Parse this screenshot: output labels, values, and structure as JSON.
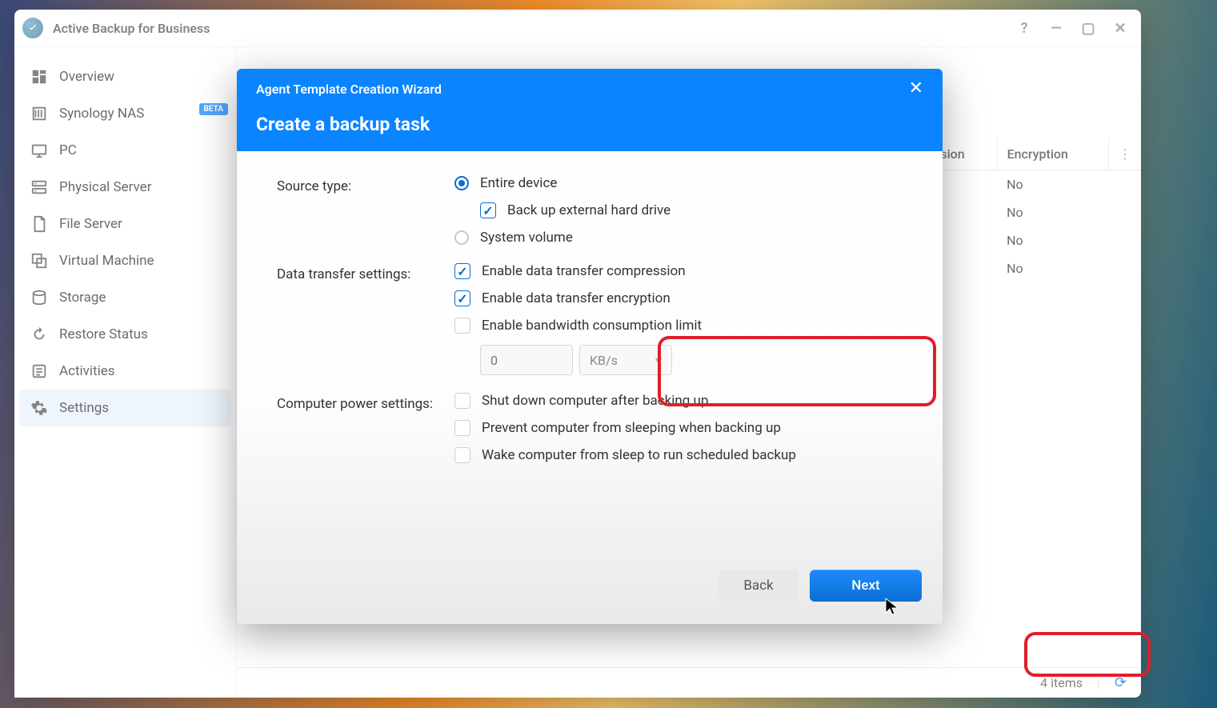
{
  "app": {
    "title": "Active Backup for Business"
  },
  "window_controls": {
    "help": "?",
    "min": "—",
    "max": "▢",
    "close": "✕"
  },
  "sidebar": {
    "items": [
      {
        "label": "Overview"
      },
      {
        "label": "Synology NAS",
        "badge": "BETA"
      },
      {
        "label": "PC"
      },
      {
        "label": "Physical Server"
      },
      {
        "label": "File Server"
      },
      {
        "label": "Virtual Machine"
      },
      {
        "label": "Storage"
      },
      {
        "label": "Restore Status"
      },
      {
        "label": "Activities"
      },
      {
        "label": "Settings"
      }
    ]
  },
  "table": {
    "columns": {
      "compression": "ession",
      "encryption": "Encryption"
    },
    "rows": [
      {
        "encryption": "No"
      },
      {
        "encryption": "No"
      },
      {
        "encryption": "No"
      },
      {
        "encryption": "No"
      }
    ]
  },
  "status": {
    "count": "4 items"
  },
  "modal": {
    "wizard_title": "Agent Template Creation Wizard",
    "heading": "Create a backup task",
    "labels": {
      "source_type": "Source type:",
      "data_transfer": "Data transfer settings:",
      "power": "Computer power settings:"
    },
    "source": {
      "entire_device": "Entire device",
      "backup_external": "Back up external hard drive",
      "system_volume": "System volume"
    },
    "transfer": {
      "compression": "Enable data transfer compression",
      "encryption": "Enable data transfer encryption",
      "bandwidth": "Enable bandwidth consumption limit",
      "bw_value": "0",
      "bw_unit": "KB/s"
    },
    "power_opts": {
      "shutdown": "Shut down computer after backing up",
      "prevent_sleep": "Prevent computer from sleeping when backing up",
      "wake": "Wake computer from sleep to run scheduled backup"
    },
    "buttons": {
      "back": "Back",
      "next": "Next"
    }
  }
}
